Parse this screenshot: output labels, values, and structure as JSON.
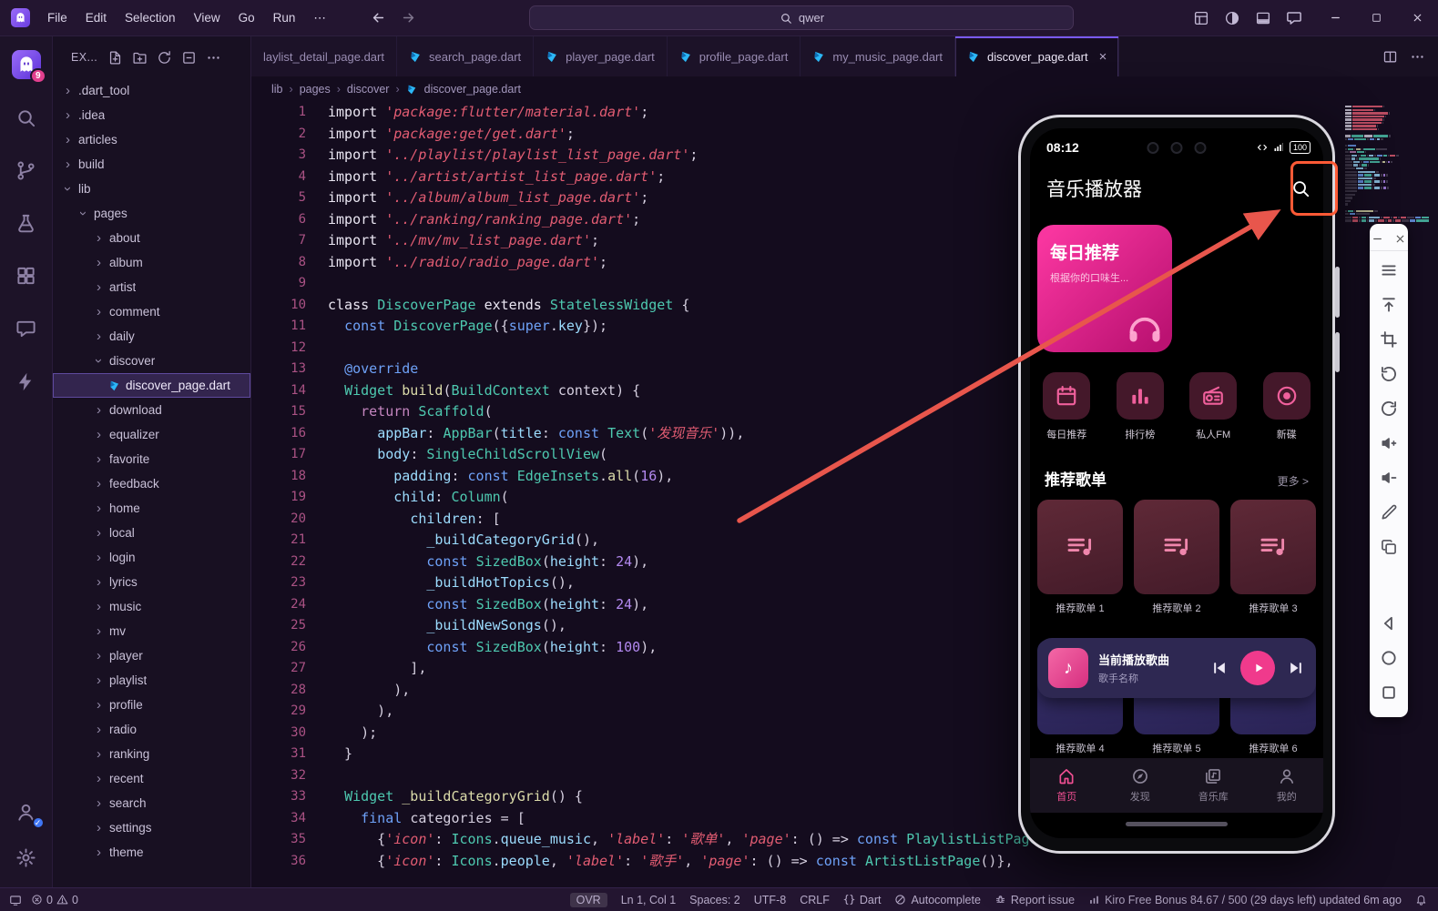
{
  "colors": {
    "accent": "#7a5af5",
    "pink": "#ef4f97",
    "annotation": "#e8564c",
    "annotation_box": "#ff5a36"
  },
  "titlebar": {
    "menus": [
      "File",
      "Edit",
      "Selection",
      "View",
      "Go",
      "Run",
      "⋯"
    ],
    "search_value": "qwer",
    "right_icons": [
      {
        "icon": "layout-grid-icon",
        "name": "customize-layout-button"
      },
      {
        "icon": "theme-toggle-icon",
        "name": "theme-toggle-button"
      },
      {
        "icon": "panel-icon",
        "name": "toggle-panel-button"
      },
      {
        "icon": "chat-icon",
        "name": "feedback-button"
      }
    ]
  },
  "activity_bar": {
    "top": [
      {
        "icon": "kiro-ghost-icon",
        "name": "explorer",
        "badge": "9",
        "active": true,
        "logo": true
      },
      {
        "icon": "search-icon",
        "name": "search"
      },
      {
        "icon": "git-branch-icon",
        "name": "source-control"
      },
      {
        "icon": "flask-icon",
        "name": "testing"
      },
      {
        "icon": "extensions-icon",
        "name": "extensions"
      },
      {
        "icon": "chat-icon",
        "name": "chat"
      },
      {
        "icon": "zap-icon",
        "name": "agent"
      }
    ],
    "bottom": [
      {
        "icon": "account-icon",
        "name": "accounts",
        "check": true
      },
      {
        "icon": "gear-icon",
        "name": "settings"
      }
    ]
  },
  "explorer": {
    "title": "EX...",
    "actions": [
      {
        "icon": "new-file-icon",
        "name": "new-file-button"
      },
      {
        "icon": "new-folder-icon",
        "name": "new-folder-button"
      },
      {
        "icon": "refresh-icon",
        "name": "refresh-explorer-button"
      },
      {
        "icon": "collapse-icon",
        "name": "collapse-folders-button"
      },
      {
        "icon": "more-icon",
        "name": "explorer-more-button"
      }
    ],
    "tree": [
      {
        "label": ".dart_tool",
        "level": 0,
        "kind": "folder"
      },
      {
        "label": ".idea",
        "level": 0,
        "kind": "folder"
      },
      {
        "label": "articles",
        "level": 0,
        "kind": "folder"
      },
      {
        "label": "build",
        "level": 0,
        "kind": "folder"
      },
      {
        "label": "lib",
        "level": 0,
        "kind": "folder",
        "expanded": true
      },
      {
        "label": "pages",
        "level": 1,
        "kind": "folder",
        "expanded": true
      },
      {
        "label": "about",
        "level": 2,
        "kind": "folder"
      },
      {
        "label": "album",
        "level": 2,
        "kind": "folder"
      },
      {
        "label": "artist",
        "level": 2,
        "kind": "folder"
      },
      {
        "label": "comment",
        "level": 2,
        "kind": "folder"
      },
      {
        "label": "daily",
        "level": 2,
        "kind": "folder"
      },
      {
        "label": "discover",
        "level": 2,
        "kind": "folder",
        "expanded": true
      },
      {
        "label": "discover_page.dart",
        "level": 3,
        "kind": "file",
        "selected": true
      },
      {
        "label": "download",
        "level": 2,
        "kind": "folder"
      },
      {
        "label": "equalizer",
        "level": 2,
        "kind": "folder"
      },
      {
        "label": "favorite",
        "level": 2,
        "kind": "folder"
      },
      {
        "label": "feedback",
        "level": 2,
        "kind": "folder"
      },
      {
        "label": "home",
        "level": 2,
        "kind": "folder"
      },
      {
        "label": "local",
        "level": 2,
        "kind": "folder"
      },
      {
        "label": "login",
        "level": 2,
        "kind": "folder"
      },
      {
        "label": "lyrics",
        "level": 2,
        "kind": "folder"
      },
      {
        "label": "music",
        "level": 2,
        "kind": "folder"
      },
      {
        "label": "mv",
        "level": 2,
        "kind": "folder"
      },
      {
        "label": "player",
        "level": 2,
        "kind": "folder"
      },
      {
        "label": "playlist",
        "level": 2,
        "kind": "folder"
      },
      {
        "label": "profile",
        "level": 2,
        "kind": "folder"
      },
      {
        "label": "radio",
        "level": 2,
        "kind": "folder"
      },
      {
        "label": "ranking",
        "level": 2,
        "kind": "folder"
      },
      {
        "label": "recent",
        "level": 2,
        "kind": "folder"
      },
      {
        "label": "search",
        "level": 2,
        "kind": "folder"
      },
      {
        "label": "settings",
        "level": 2,
        "kind": "folder"
      },
      {
        "label": "theme",
        "level": 2,
        "kind": "folder"
      }
    ]
  },
  "editor_tabs": [
    {
      "label": "laylist_detail_page.dart",
      "clipped": true
    },
    {
      "label": "search_page.dart"
    },
    {
      "label": "player_page.dart"
    },
    {
      "label": "profile_page.dart"
    },
    {
      "label": "my_music_page.dart"
    },
    {
      "label": "discover_page.dart",
      "active": true
    }
  ],
  "breadcrumb": {
    "items": [
      "lib",
      "pages",
      "discover",
      "discover_page.dart"
    ]
  },
  "code": {
    "lines": [
      [
        [
          "k",
          "import "
        ],
        [
          "s",
          "'package:flutter/material.dart'"
        ],
        [
          "p",
          ";"
        ]
      ],
      [
        [
          "k",
          "import "
        ],
        [
          "s",
          "'package:get/get.dart'"
        ],
        [
          "p",
          ";"
        ]
      ],
      [
        [
          "k",
          "import "
        ],
        [
          "s",
          "'../playlist/playlist_list_page.dart'"
        ],
        [
          "p",
          ";"
        ]
      ],
      [
        [
          "k",
          "import "
        ],
        [
          "s",
          "'../artist/artist_list_page.dart'"
        ],
        [
          "p",
          ";"
        ]
      ],
      [
        [
          "k",
          "import "
        ],
        [
          "s",
          "'../album/album_list_page.dart'"
        ],
        [
          "p",
          ";"
        ]
      ],
      [
        [
          "k",
          "import "
        ],
        [
          "s",
          "'../ranking/ranking_page.dart'"
        ],
        [
          "p",
          ";"
        ]
      ],
      [
        [
          "k",
          "import "
        ],
        [
          "s",
          "'../mv/mv_list_page.dart'"
        ],
        [
          "p",
          ";"
        ]
      ],
      [
        [
          "k",
          "import "
        ],
        [
          "s",
          "'../radio/radio_page.dart'"
        ],
        [
          "p",
          ";"
        ]
      ],
      [],
      [
        [
          "k",
          "class "
        ],
        [
          "t",
          "DiscoverPage"
        ],
        [
          "k",
          " extends "
        ],
        [
          "t",
          "StatelessWidget"
        ],
        [
          "p",
          " {"
        ]
      ],
      [
        [
          "p",
          "  "
        ],
        [
          "b",
          "const "
        ],
        [
          "t",
          "DiscoverPage"
        ],
        [
          "p",
          "({"
        ],
        [
          "b",
          "super"
        ],
        [
          "p",
          "."
        ],
        [
          "v",
          "key"
        ],
        [
          "p",
          "});"
        ]
      ],
      [],
      [
        [
          "p",
          "  "
        ],
        [
          "b",
          "@override"
        ]
      ],
      [
        [
          "p",
          "  "
        ],
        [
          "t",
          "Widget"
        ],
        [
          "p",
          " "
        ],
        [
          "f",
          "build"
        ],
        [
          "p",
          "("
        ],
        [
          "t",
          "BuildContext"
        ],
        [
          "p",
          " context) {"
        ]
      ],
      [
        [
          "p",
          "    "
        ],
        [
          "m",
          "return "
        ],
        [
          "t",
          "Scaffold"
        ],
        [
          "p",
          "("
        ]
      ],
      [
        [
          "p",
          "      "
        ],
        [
          "v",
          "appBar"
        ],
        [
          "p",
          ": "
        ],
        [
          "t",
          "AppBar"
        ],
        [
          "p",
          "("
        ],
        [
          "v",
          "title"
        ],
        [
          "p",
          ": "
        ],
        [
          "b",
          "const "
        ],
        [
          "t",
          "Text"
        ],
        [
          "p",
          "("
        ],
        [
          "s",
          "'发现音乐'"
        ],
        [
          "p",
          ")),"
        ]
      ],
      [
        [
          "p",
          "      "
        ],
        [
          "v",
          "body"
        ],
        [
          "p",
          ": "
        ],
        [
          "t",
          "SingleChildScrollView"
        ],
        [
          "p",
          "("
        ]
      ],
      [
        [
          "p",
          "        "
        ],
        [
          "v",
          "padding"
        ],
        [
          "p",
          ": "
        ],
        [
          "b",
          "const "
        ],
        [
          "t",
          "EdgeInsets"
        ],
        [
          "p",
          "."
        ],
        [
          "f",
          "all"
        ],
        [
          "p",
          "("
        ],
        [
          "n",
          "16"
        ],
        [
          "p",
          "),"
        ]
      ],
      [
        [
          "p",
          "        "
        ],
        [
          "v",
          "child"
        ],
        [
          "p",
          ": "
        ],
        [
          "t",
          "Column"
        ],
        [
          "p",
          "("
        ]
      ],
      [
        [
          "p",
          "          "
        ],
        [
          "v",
          "children"
        ],
        [
          "p",
          ": ["
        ]
      ],
      [
        [
          "p",
          "            "
        ],
        [
          "v",
          "_buildCategoryGrid"
        ],
        [
          "p",
          "(),"
        ]
      ],
      [
        [
          "p",
          "            "
        ],
        [
          "b",
          "const "
        ],
        [
          "t",
          "SizedBox"
        ],
        [
          "p",
          "("
        ],
        [
          "v",
          "height"
        ],
        [
          "p",
          ": "
        ],
        [
          "n",
          "24"
        ],
        [
          "p",
          "),"
        ]
      ],
      [
        [
          "p",
          "            "
        ],
        [
          "v",
          "_buildHotTopics"
        ],
        [
          "p",
          "(),"
        ]
      ],
      [
        [
          "p",
          "            "
        ],
        [
          "b",
          "const "
        ],
        [
          "t",
          "SizedBox"
        ],
        [
          "p",
          "("
        ],
        [
          "v",
          "height"
        ],
        [
          "p",
          ": "
        ],
        [
          "n",
          "24"
        ],
        [
          "p",
          "),"
        ]
      ],
      [
        [
          "p",
          "            "
        ],
        [
          "v",
          "_buildNewSongs"
        ],
        [
          "p",
          "(),"
        ]
      ],
      [
        [
          "p",
          "            "
        ],
        [
          "b",
          "const "
        ],
        [
          "t",
          "SizedBox"
        ],
        [
          "p",
          "("
        ],
        [
          "v",
          "height"
        ],
        [
          "p",
          ": "
        ],
        [
          "n",
          "100"
        ],
        [
          "p",
          "),"
        ]
      ],
      [
        [
          "p",
          "          ],"
        ]
      ],
      [
        [
          "p",
          "        ),"
        ]
      ],
      [
        [
          "p",
          "      ),"
        ]
      ],
      [
        [
          "p",
          "    );"
        ]
      ],
      [
        [
          "p",
          "  }"
        ]
      ],
      [],
      [
        [
          "p",
          "  "
        ],
        [
          "t",
          "Widget"
        ],
        [
          "p",
          " "
        ],
        [
          "f",
          "_buildCategoryGrid"
        ],
        [
          "p",
          "() {"
        ]
      ],
      [
        [
          "p",
          "    "
        ],
        [
          "b",
          "final "
        ],
        [
          "p",
          "categories = ["
        ]
      ],
      [
        [
          "p",
          "      {"
        ],
        [
          "s",
          "'icon'"
        ],
        [
          "p",
          ": "
        ],
        [
          "t",
          "Icons"
        ],
        [
          "p",
          "."
        ],
        [
          "v",
          "queue_music"
        ],
        [
          "p",
          ", "
        ],
        [
          "s",
          "'label'"
        ],
        [
          "p",
          ": "
        ],
        [
          "s",
          "'歌单'"
        ],
        [
          "p",
          ", "
        ],
        [
          "s",
          "'page'"
        ],
        [
          "p",
          ": () => "
        ],
        [
          "b",
          "const "
        ],
        [
          "t",
          "PlaylistListPage"
        ],
        [
          "p",
          "()},"
        ]
      ],
      [
        [
          "p",
          "      {"
        ],
        [
          "s",
          "'icon'"
        ],
        [
          "p",
          ": "
        ],
        [
          "t",
          "Icons"
        ],
        [
          "p",
          "."
        ],
        [
          "v",
          "people"
        ],
        [
          "p",
          ", "
        ],
        [
          "s",
          "'label'"
        ],
        [
          "p",
          ": "
        ],
        [
          "s",
          "'歌手'"
        ],
        [
          "p",
          ", "
        ],
        [
          "s",
          "'page'"
        ],
        [
          "p",
          ": () => "
        ],
        [
          "b",
          "const "
        ],
        [
          "t",
          "ArtistListPage"
        ],
        [
          "p",
          "()},"
        ]
      ]
    ]
  },
  "phone": {
    "status": {
      "time": "08:12",
      "battery": "100"
    },
    "app_bar": {
      "title": "音乐播放器"
    },
    "banner": {
      "title": "每日推荐",
      "subtitle": "根据你的口味生..."
    },
    "categories": [
      {
        "icon": "calendar-icon",
        "label": "每日推荐",
        "name": "category-daily-recommend"
      },
      {
        "icon": "bar-chart-icon",
        "label": "排行榜",
        "name": "category-ranking"
      },
      {
        "icon": "radio-icon",
        "label": "私人FM",
        "name": "category-personal-fm"
      },
      {
        "icon": "disc-icon",
        "label": "新碟",
        "name": "category-new-albums"
      }
    ],
    "section": {
      "title": "推荐歌单",
      "more": "更多 >"
    },
    "playlists_row1": [
      "推荐歌单 1",
      "推荐歌单 2",
      "推荐歌单 3"
    ],
    "playlists_row2": [
      "推荐歌单 4",
      "推荐歌单 5",
      "推荐歌单 6"
    ],
    "mini_player": {
      "song": "当前播放歌曲",
      "artist": "歌手名称"
    },
    "nav": [
      {
        "icon": "home-icon",
        "label": "首页",
        "name": "nav-home",
        "active": true
      },
      {
        "icon": "compass-icon",
        "label": "发现",
        "name": "nav-discover"
      },
      {
        "icon": "library-icon",
        "label": "音乐库",
        "name": "nav-music-library"
      },
      {
        "icon": "account-icon",
        "label": "我的",
        "name": "nav-mine"
      }
    ]
  },
  "emulator_toolbar": {
    "header": [
      {
        "icon": "minus-icon",
        "name": "emu-minimize-button"
      },
      {
        "icon": "close-x-icon",
        "name": "emu-close-button"
      }
    ],
    "buttons": [
      {
        "icon": "menu-icon",
        "name": "emu-menu-button"
      },
      {
        "icon": "scroll-top-icon",
        "name": "emu-scroll-top-button"
      },
      {
        "icon": "crop-icon",
        "name": "emu-screenshot-button"
      },
      {
        "icon": "rotate-ccw-icon",
        "name": "emu-rotate-button"
      },
      {
        "icon": "rotate-cw-icon",
        "name": "emu-sync-button"
      },
      {
        "icon": "volume-up-icon",
        "name": "emu-volume-up-button"
      },
      {
        "icon": "volume-down-icon",
        "name": "emu-volume-down-button"
      },
      {
        "icon": "pen-icon",
        "name": "emu-annotate-button"
      },
      {
        "icon": "copy-icon",
        "name": "emu-copy-button"
      },
      {
        "icon": "tri-left-icon",
        "name": "emu-android-back-button",
        "spacer": true
      },
      {
        "icon": "nav-circle-icon",
        "name": "emu-android-home-button"
      },
      {
        "icon": "nav-square-icon",
        "name": "emu-android-recents-button"
      }
    ]
  },
  "status_bar": {
    "errors": "0",
    "warnings": "0",
    "items_right": [
      {
        "label": "OVR",
        "name": "overtype-indicator",
        "boxed": true
      },
      {
        "label": "Ln 1, Col 1",
        "name": "cursor-position"
      },
      {
        "label": "Spaces: 2",
        "name": "indentation"
      },
      {
        "label": "UTF-8",
        "name": "encoding"
      },
      {
        "label": "CRLF",
        "name": "end-of-line"
      },
      {
        "label": "Dart",
        "name": "language-mode",
        "icon": "braces-icon"
      },
      {
        "label": "Autocomplete",
        "name": "autocomplete-status",
        "icon": "slash-circle-icon"
      },
      {
        "label": "Report issue",
        "name": "report-issue",
        "icon": "bug-icon"
      },
      {
        "label": "Kiro Free Bonus 84.67 / 500 (29 days left) updated 6m ago",
        "name": "kiro-bonus-meter",
        "icon": "meter-icon"
      }
    ]
  }
}
